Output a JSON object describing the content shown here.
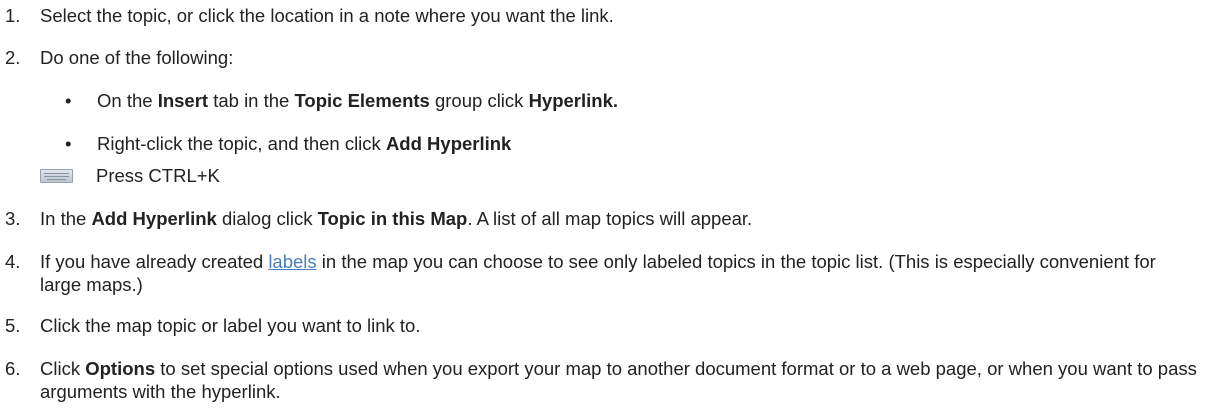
{
  "steps": [
    {
      "number": "1.",
      "text": "Select the topic, or click the location in a note where you want the link."
    },
    {
      "number": "2.",
      "text": "Do one of the following:",
      "bullets": [
        {
          "dot": "•",
          "parts": [
            "On the ",
            "Insert",
            " tab in the ",
            "Topic Elements",
            " group click ",
            "Hyperlink."
          ]
        },
        {
          "dot": "•",
          "parts": [
            "Right-click the topic, and then click ",
            "Add Hyperlink"
          ]
        }
      ],
      "shortcut": {
        "icon": "keyboard-icon",
        "text": "Press CTRL+K"
      }
    },
    {
      "number": "3.",
      "parts": [
        "In the ",
        "Add Hyperlink",
        " dialog click ",
        "Topic in this Map",
        ". A list of all map topics will appear."
      ]
    },
    {
      "number": "4.",
      "parts": [
        "If you have already created ",
        "labels",
        " in the map you can choose to see only labeled topics in the topic list. (This is especially convenient for large maps.)"
      ]
    },
    {
      "number": "5.",
      "text": "Click the map topic or label you want to link to."
    },
    {
      "number": "6.",
      "parts": [
        "Click ",
        "Options",
        " to set special options used when you export your map to another document format or to a web page, or when you want to pass arguments with the hyperlink."
      ]
    }
  ],
  "colors": {
    "text": "#222222",
    "link": "#4a7db8"
  }
}
